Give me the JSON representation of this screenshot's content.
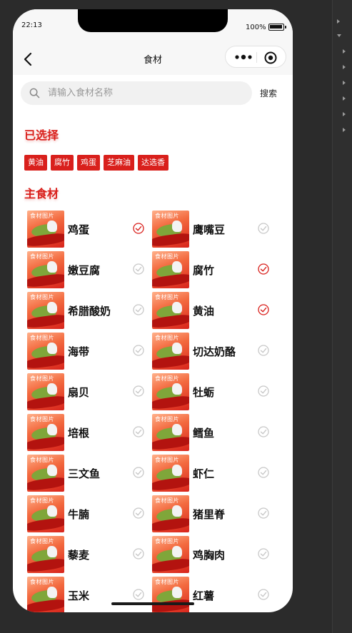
{
  "status": {
    "time": "22:13",
    "battery": "100%"
  },
  "nav": {
    "title": "食材"
  },
  "search": {
    "placeholder": "请输入食材名称",
    "button": "搜索"
  },
  "selected": {
    "title": "已选择",
    "tags": [
      "黄油",
      "腐竹",
      "鸡蛋",
      "芝麻油",
      "达选香"
    ]
  },
  "main": {
    "title": "主食材",
    "thumb_caption": "食材图片",
    "items": [
      {
        "name": "鸡蛋",
        "checked": true
      },
      {
        "name": "鹰嘴豆",
        "checked": false
      },
      {
        "name": "嫩豆腐",
        "checked": false
      },
      {
        "name": "腐竹",
        "checked": true
      },
      {
        "name": "希腊酸奶",
        "checked": false
      },
      {
        "name": "黄油",
        "checked": true
      },
      {
        "name": "海带",
        "checked": false
      },
      {
        "name": "切达奶酪",
        "checked": false
      },
      {
        "name": "扇贝",
        "checked": false
      },
      {
        "name": "牡蛎",
        "checked": false
      },
      {
        "name": "培根",
        "checked": false
      },
      {
        "name": "鳕鱼",
        "checked": false
      },
      {
        "name": "三文鱼",
        "checked": false
      },
      {
        "name": "虾仁",
        "checked": false
      },
      {
        "name": "牛腩",
        "checked": false
      },
      {
        "name": "猪里脊",
        "checked": false
      },
      {
        "name": "藜麦",
        "checked": false
      },
      {
        "name": "鸡胸肉",
        "checked": false
      },
      {
        "name": "玉米",
        "checked": false
      },
      {
        "name": "红薯",
        "checked": false
      }
    ]
  },
  "colors": {
    "accent": "#d9201c",
    "check_on": "#d9201c",
    "check_off": "#c8c8c8"
  }
}
